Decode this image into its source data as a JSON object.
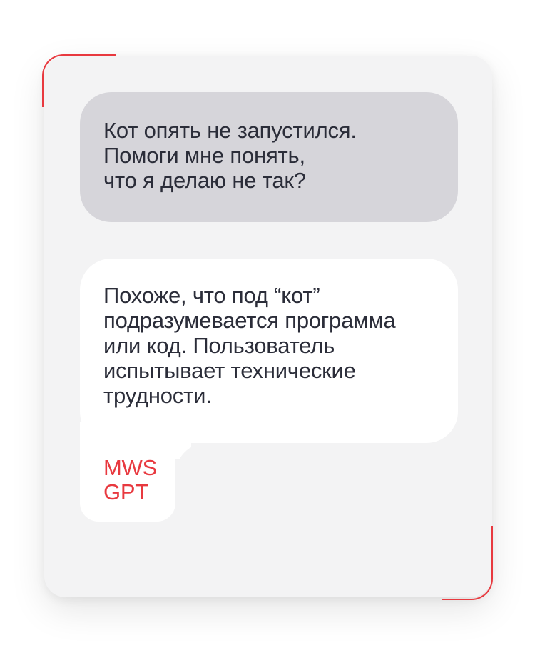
{
  "chat": {
    "user_message": "Кот опять не запустился.\nПомоги мне понять,\nчто я делаю не так?",
    "bot_message": "Похоже, что под “кот”\nподразумевается программа\nили код. Пользователь\nиспытывает технические\nтрудности.",
    "bot_name": "MWS\nGPT"
  },
  "colors": {
    "accent": "#e8393f",
    "card_bg": "#f3f3f4",
    "user_bubble": "#d6d5da",
    "bot_bubble": "#ffffff",
    "text": "#2b2d39"
  }
}
